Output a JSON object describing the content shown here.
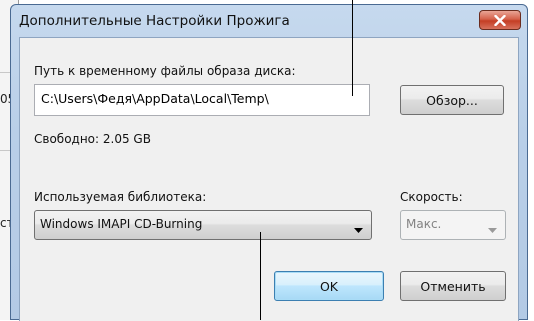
{
  "background": {
    "fragments": [
      "05",
      "ст"
    ]
  },
  "dialog": {
    "title": "Дополнительные Настройки Прожига",
    "close_icon": "close-x-icon",
    "path_label": "Путь к временному файлы образа диска:",
    "path_value": "C:\\Users\\Федя\\AppData\\Local\\Temp\\",
    "browse_button": "Обзор...",
    "free_space": "Свободно: 2.05 GB",
    "library_label": "Используемая библиотека:",
    "library_value": "Windows IMAPI CD-Burning",
    "speed_label": "Скорость:",
    "speed_value": "Макс.",
    "ok_button": "OK",
    "cancel_button": "Отменить"
  },
  "colors": {
    "title_bar": "#b9cfe8",
    "close_button": "#c43e24",
    "default_button_border": "#3c7fb1"
  }
}
